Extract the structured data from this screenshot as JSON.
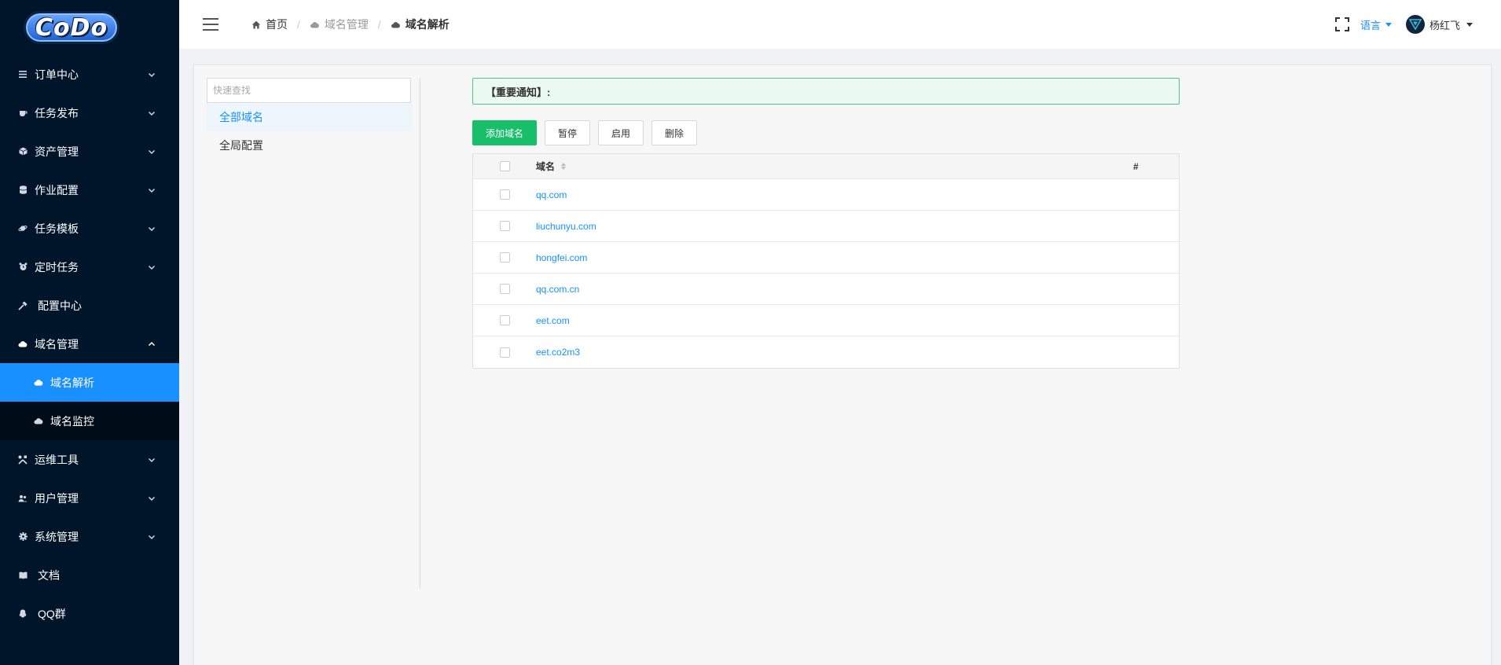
{
  "app": {
    "logo_text": "CoDo"
  },
  "sidebar": {
    "items": [
      {
        "label": "订单中心",
        "icon": "list-icon",
        "expandable": true
      },
      {
        "label": "任务发布",
        "icon": "cup-icon",
        "expandable": true
      },
      {
        "label": "资产管理",
        "icon": "cube-icon",
        "expandable": true
      },
      {
        "label": "作业配置",
        "icon": "database-icon",
        "expandable": true
      },
      {
        "label": "任务模板",
        "icon": "planet-icon",
        "expandable": true
      },
      {
        "label": "定时任务",
        "icon": "alarm-icon",
        "expandable": true
      },
      {
        "label": "配置中心",
        "icon": "hammer-icon",
        "expandable": false
      },
      {
        "label": "域名管理",
        "icon": "cloud-icon",
        "expandable": true,
        "expanded": true
      },
      {
        "label": "运维工具",
        "icon": "tools-icon",
        "expandable": true
      },
      {
        "label": "用户管理",
        "icon": "users-icon",
        "expandable": true
      },
      {
        "label": "系统管理",
        "icon": "gear-icon",
        "expandable": true
      },
      {
        "label": "文档",
        "icon": "book-icon",
        "expandable": false
      },
      {
        "label": "QQ群",
        "icon": "qq-icon",
        "expandable": false
      }
    ],
    "submenu": [
      {
        "label": "域名解析",
        "icon": "cloud-icon",
        "active": true
      },
      {
        "label": "域名监控",
        "icon": "cloud-icon",
        "active": false
      }
    ]
  },
  "header": {
    "breadcrumb": [
      {
        "label": "首页",
        "icon": "home-icon"
      },
      {
        "label": "域名管理",
        "icon": "cloud-icon"
      },
      {
        "label": "域名解析",
        "icon": "cloud-icon"
      }
    ],
    "language_label": "语言",
    "username": "杨红飞"
  },
  "left_panel": {
    "search_placeholder": "快速查找",
    "items": [
      {
        "label": "全部域名",
        "active": true
      },
      {
        "label": "全局配置",
        "active": false
      }
    ]
  },
  "notice": {
    "text": "【重要通知】:"
  },
  "toolbar": {
    "add_label": "添加域名",
    "pause_label": "暂停",
    "enable_label": "启用",
    "delete_label": "删除"
  },
  "table": {
    "columns": {
      "domain": "域名",
      "action": "#"
    },
    "rows": [
      {
        "domain": "qq.com"
      },
      {
        "domain": "liuchunyu.com"
      },
      {
        "domain": "hongfei.com"
      },
      {
        "domain": "qq.com.cn"
      },
      {
        "domain": "eet.com"
      },
      {
        "domain": "eet.co2m3"
      }
    ]
  },
  "colors": {
    "sidebar_bg": "#001529",
    "accent": "#1890ff",
    "primary_button": "#19be6b",
    "notice_bg": "#eafaf1"
  }
}
